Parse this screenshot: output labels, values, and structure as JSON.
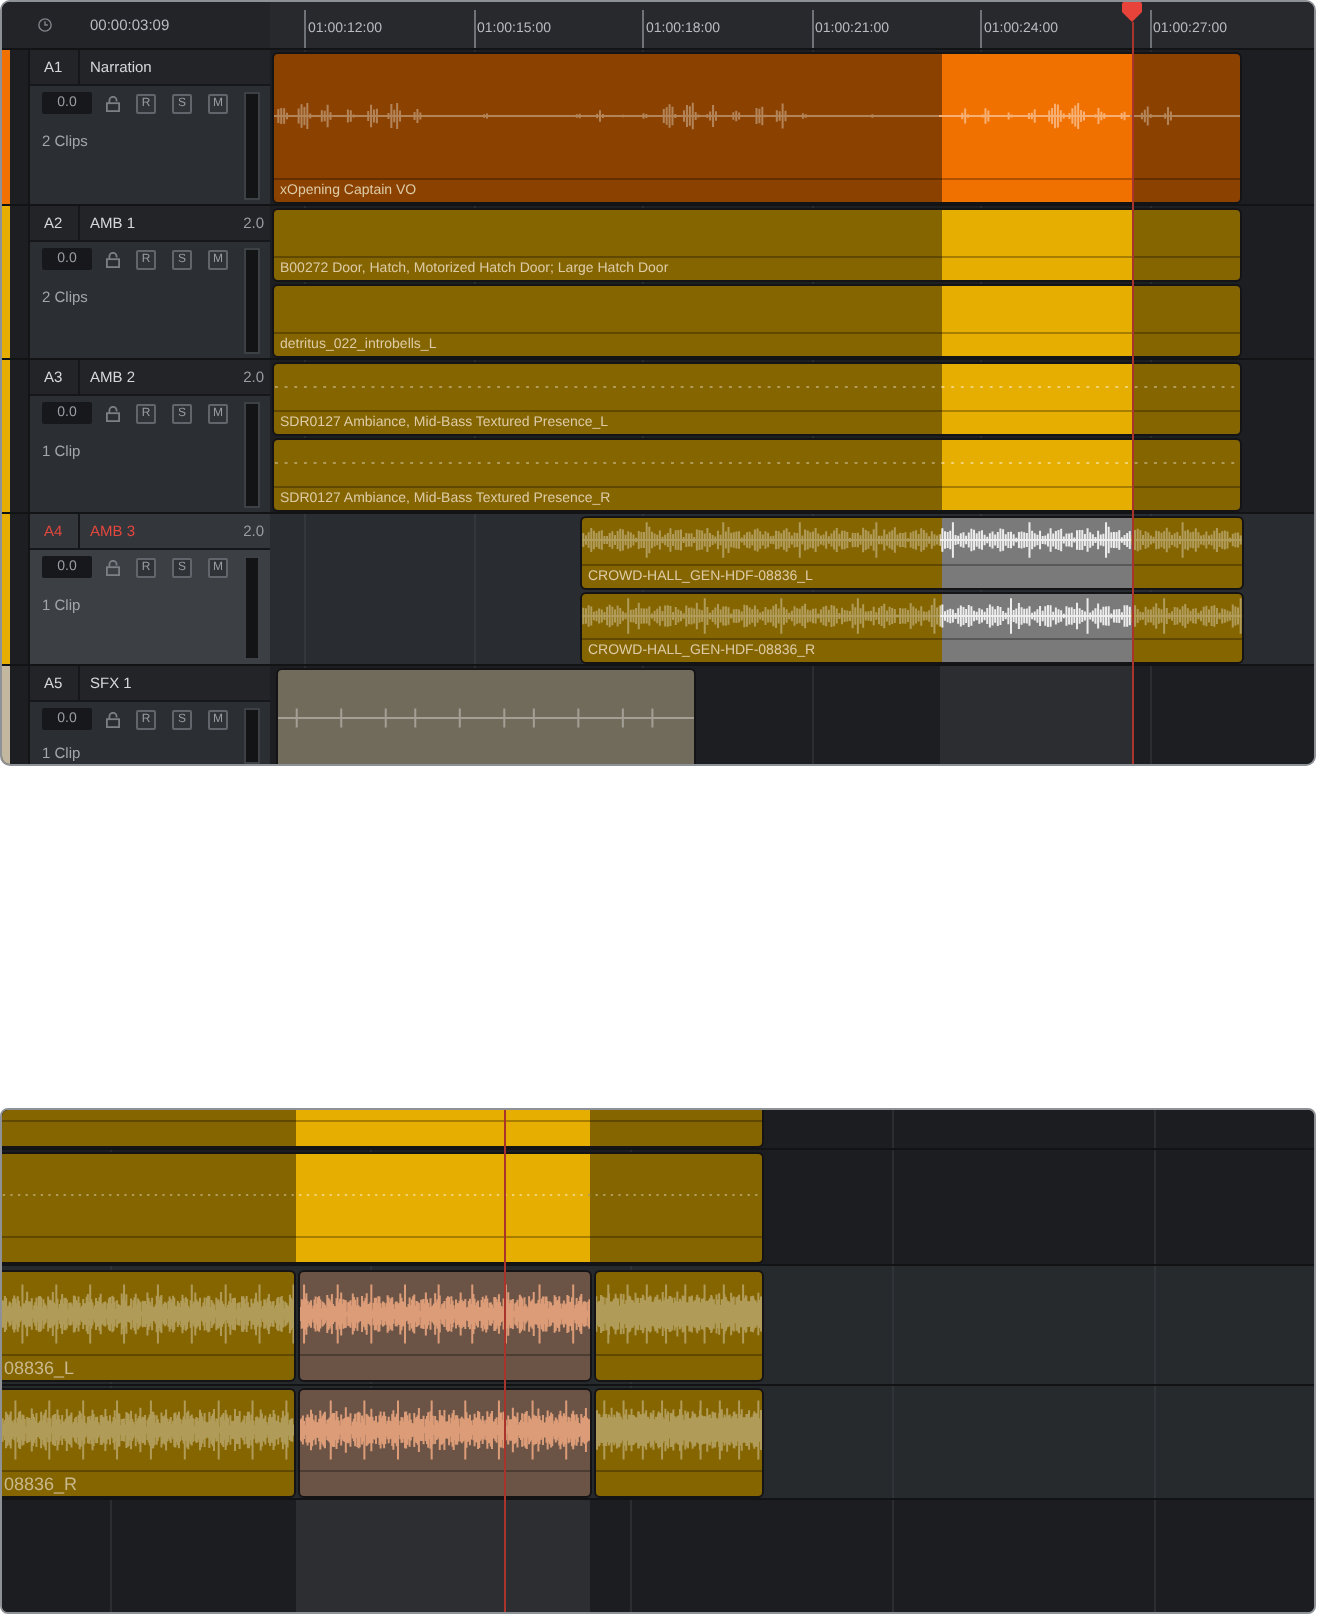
{
  "timeline": {
    "timecode": "00:00:03:09",
    "ruler": [
      "01:00:12:00",
      "01:00:15:00",
      "01:00:18:00",
      "01:00:21:00",
      "01:00:24:00",
      "01:00:27:00"
    ],
    "tracks": [
      {
        "id": "A1",
        "name": "Narration",
        "volume": "0.0",
        "buttons": [
          "R",
          "S",
          "M"
        ],
        "clip_count": "2 Clips",
        "selected": false,
        "color": "#f07000",
        "kind": "speech",
        "clips": [
          {
            "label": "xOpening Captain VO",
            "highlighted": true,
            "selected": false
          }
        ]
      },
      {
        "id": "A2",
        "name": "AMB 1",
        "format": "2.0",
        "volume": "0.0",
        "buttons": [
          "R",
          "S",
          "M"
        ],
        "clip_count": "2 Clips",
        "selected": false,
        "color": "#e6ae00",
        "kind": "silent",
        "clips": [
          {
            "label": "B00272 Door, Hatch, Motorized Hatch Door; Large Hatch Door",
            "highlighted": true,
            "selected": false
          },
          {
            "label": "detritus_022_introbells_L",
            "highlighted": true,
            "selected": false
          }
        ]
      },
      {
        "id": "A3",
        "name": "AMB 2",
        "format": "2.0",
        "volume": "0.0",
        "buttons": [
          "R",
          "S",
          "M"
        ],
        "clip_count": "1 Clip",
        "selected": false,
        "color": "#e6ae00",
        "kind": "flat",
        "clips": [
          {
            "label": "SDR0127 Ambiance, Mid-Bass Textured Presence_L",
            "highlighted": true,
            "selected": false
          },
          {
            "label": "SDR0127 Ambiance, Mid-Bass Textured Presence_R",
            "highlighted": true,
            "selected": false
          }
        ]
      },
      {
        "id": "A4",
        "name": "AMB 3",
        "format": "2.0",
        "volume": "0.0",
        "buttons": [
          "R",
          "S",
          "M"
        ],
        "clip_count": "1 Clip",
        "selected": true,
        "color": "#e6ae00",
        "kind": "dense",
        "clips": [
          {
            "label": "CROWD-HALL_GEN-HDF-08836_L",
            "highlighted": true,
            "selected": true
          },
          {
            "label": "CROWD-HALL_GEN-HDF-08836_R",
            "highlighted": true,
            "selected": true
          }
        ]
      },
      {
        "id": "A5",
        "name": "SFX 1",
        "volume": "0.0",
        "buttons": [
          "R",
          "S",
          "M"
        ],
        "clip_count": "1 Clip",
        "selected": false,
        "color": "#c3b89f",
        "kind": "sparse",
        "clips": [
          {
            "selected": false
          }
        ]
      }
    ]
  },
  "detail_view": {
    "lanes": [
      {
        "kind": "silent",
        "clips": [
          {
            "highlighted": true,
            "selected": false
          }
        ]
      },
      {
        "kind": "flat",
        "clips": [
          {
            "highlighted": true,
            "selected": false
          }
        ]
      },
      {
        "kind": "dense",
        "clips": [
          {
            "label": "08836_L",
            "selected": false
          },
          {
            "selected": true
          },
          {
            "selected": false
          }
        ]
      },
      {
        "kind": "dense",
        "clips": [
          {
            "label": "08836_R",
            "selected": false
          },
          {
            "selected": true
          },
          {
            "selected": false
          }
        ]
      }
    ]
  }
}
